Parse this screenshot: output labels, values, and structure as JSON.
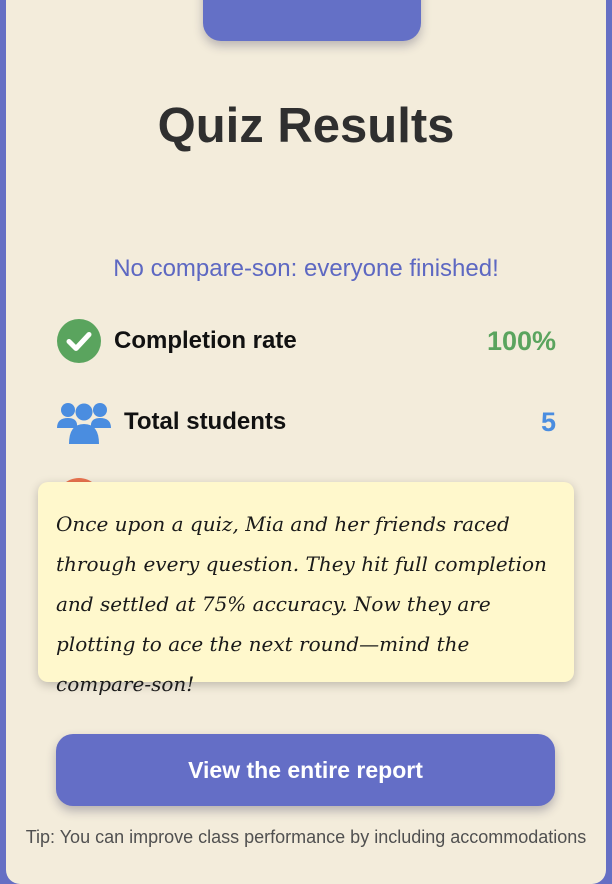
{
  "header": {
    "title": "Quiz Results",
    "subtitle": "No compare-son: everyone finished!"
  },
  "stats": [
    {
      "label": "Completion rate",
      "value": "100%",
      "icon": "check-circle-icon",
      "color": "#5aa45e"
    },
    {
      "label": "Total students",
      "value": "5",
      "icon": "users-icon",
      "color": "#4a8de0"
    }
  ],
  "story": {
    "text": "Once upon a quiz, Mia and her friends raced through every question. They hit full completion and settled at 75% accuracy. Now they are plotting to ace the next round—mind the compare-son!"
  },
  "actions": {
    "report_label": "View the entire report"
  },
  "footer": {
    "tip": "Tip: You can improve class performance by including accommodations"
  },
  "colors": {
    "accent": "#646ec6",
    "background": "#f3ecdb",
    "note": "#fff8cc",
    "partial_icon": "#e9734f"
  }
}
